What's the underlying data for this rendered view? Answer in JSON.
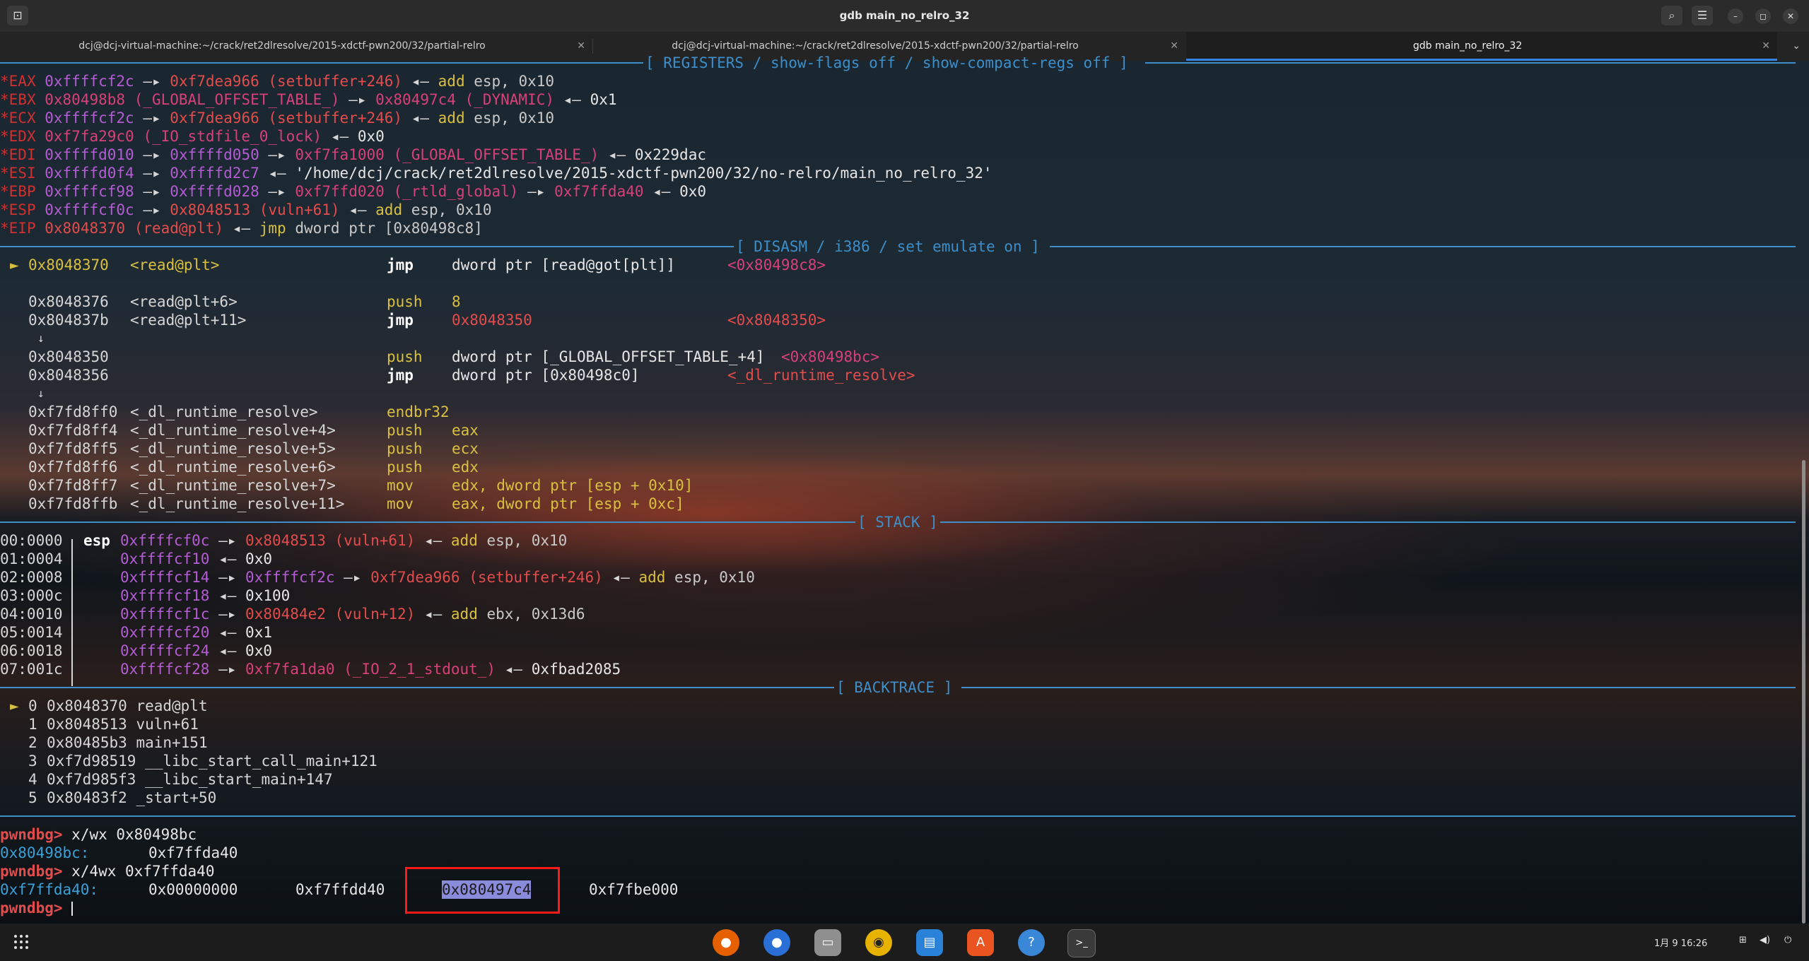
{
  "window": {
    "title": "gdb main_no_relro_32",
    "buttons": {
      "search": "⌕",
      "menu": "☰",
      "minimize": "–",
      "maximize": "◻",
      "close": "✕"
    }
  },
  "tabs": [
    {
      "label": "dcj@dcj-virtual-machine:~/crack/ret2dlresolve/2015-xdctf-pwn200/32/partial-relro",
      "active": false
    },
    {
      "label": "dcj@dcj-virtual-machine:~/crack/ret2dlresolve/2015-xdctf-pwn200/32/partial-relro",
      "active": false
    },
    {
      "label": "gdb main_no_relro_32",
      "active": true
    }
  ],
  "headers": {
    "registers": "[ REGISTERS / show-flags off / show-compact-regs off ]",
    "disasm": "[ DISASM / i386 / set emulate on ]",
    "stack": "[ STACK ]",
    "backtrace": "[ BACKTRACE ]"
  },
  "registers": [
    {
      "star": "*",
      "name": "EAX",
      "v1": "0xffffcf2c",
      "a1": "—▸",
      "v2": "0xf7dea966",
      "sym": "(setbuffer+246)",
      "a2": "◂—",
      "ins": "add",
      "opr": "esp, 0x10"
    },
    {
      "star": "*",
      "name": "EBX",
      "v1": "0x80498b8",
      "sym1": "(_GLOBAL_OFFSET_TABLE_)",
      "a1": "—▸",
      "v2": "0x80497c4",
      "sym": "(_DYNAMIC)",
      "a2": "◂—",
      "tail": "0x1"
    },
    {
      "star": "*",
      "name": "ECX",
      "v1": "0xffffcf2c",
      "a1": "—▸",
      "v2": "0xf7dea966",
      "sym": "(setbuffer+246)",
      "a2": "◂—",
      "ins": "add",
      "opr": "esp, 0x10"
    },
    {
      "star": "*",
      "name": "EDX",
      "v1": "0xf7fa29c0",
      "sym1": "(_IO_stdfile_0_lock)",
      "a2": "◂—",
      "tail": "0x0"
    },
    {
      "star": "*",
      "name": "EDI",
      "v1": "0xffffd010",
      "a1": "—▸",
      "v2": "0xffffd050",
      "a3": "—▸",
      "v3": "0xf7fa1000",
      "sym": "(_GLOBAL_OFFSET_TABLE_)",
      "a2": "◂—",
      "tail": "0x229dac"
    },
    {
      "star": "*",
      "name": "ESI",
      "v1": "0xffffd0f4",
      "a1": "—▸",
      "v2": "0xffffd2c7",
      "a2": "◂—",
      "str": "'/home/dcj/crack/ret2dlresolve/2015-xdctf-pwn200/32/no-relro/main_no_relro_32'"
    },
    {
      "star": "*",
      "name": "EBP",
      "v1": "0xffffcf98",
      "a1": "—▸",
      "v2": "0xffffd028",
      "a3": "—▸",
      "v3": "0xf7ffd020",
      "sym": "(_rtld_global)",
      "a4": "—▸",
      "v4": "0xf7ffda40",
      "a2": "◂—",
      "tail": "0x0"
    },
    {
      "star": "*",
      "name": "ESP",
      "v1": "0xffffcf0c",
      "a1": "—▸",
      "v2": "0x8048513",
      "sym": "(vuln+61)",
      "a2": "◂—",
      "ins": "add",
      "opr": "esp, 0x10"
    },
    {
      "star": "*",
      "name": "EIP",
      "v1": "0x8048370",
      "sym": "(read@plt)",
      "a2": "◂—",
      "ins": "jmp",
      "opr": "dword ptr [0x80498c8]"
    }
  ],
  "disasm": [
    {
      "marker": "►",
      "addr": "0x8048370",
      "sym": "<read@plt>",
      "mnem": "jmp",
      "ops": "dword ptr [read@got[plt]]",
      "cmt": "<0x80498c8>",
      "current": true
    },
    {
      "marker": "",
      "addr": "",
      "sym": "",
      "mnem": "",
      "ops": "",
      "cmt": ""
    },
    {
      "marker": "",
      "addr": "0x8048376",
      "sym": "<read@plt+6>",
      "mnem": "push",
      "ops": "8",
      "cmt": ""
    },
    {
      "marker": "",
      "addr": "0x804837b",
      "sym": "<read@plt+11>",
      "mnem": "jmp",
      "ops": "0x8048350",
      "cmt": "<0x8048350>"
    },
    {
      "marker": "↓",
      "addr": "",
      "sym": "",
      "mnem": "",
      "ops": "",
      "cmt": ""
    },
    {
      "marker": "",
      "addr": "0x8048350",
      "sym": "",
      "mnem": "push",
      "ops": "dword ptr [_GLOBAL_OFFSET_TABLE_+4]",
      "cmt": "<0x80498bc>"
    },
    {
      "marker": "",
      "addr": "0x8048356",
      "sym": "",
      "mnem": "jmp",
      "ops": "dword ptr [0x80498c0]",
      "cmt": "<_dl_runtime_resolve>"
    },
    {
      "marker": "↓",
      "addr": "",
      "sym": "",
      "mnem": "",
      "ops": "",
      "cmt": ""
    },
    {
      "marker": "",
      "addr": "0xf7fd8ff0",
      "sym": "<_dl_runtime_resolve>",
      "mnem": "endbr32",
      "ops": "",
      "cmt": ""
    },
    {
      "marker": "",
      "addr": "0xf7fd8ff4",
      "sym": "<_dl_runtime_resolve+4>",
      "mnem": "push",
      "ops": "eax",
      "cmt": ""
    },
    {
      "marker": "",
      "addr": "0xf7fd8ff5",
      "sym": "<_dl_runtime_resolve+5>",
      "mnem": "push",
      "ops": "ecx",
      "cmt": ""
    },
    {
      "marker": "",
      "addr": "0xf7fd8ff6",
      "sym": "<_dl_runtime_resolve+6>",
      "mnem": "push",
      "ops": "edx",
      "cmt": ""
    },
    {
      "marker": "",
      "addr": "0xf7fd8ff7",
      "sym": "<_dl_runtime_resolve+7>",
      "mnem": "mov",
      "ops": "edx, dword ptr [esp + 0x10]",
      "cmt": ""
    },
    {
      "marker": "",
      "addr": "0xf7fd8ffb",
      "sym": "<_dl_runtime_resolve+11>",
      "mnem": "mov",
      "ops": "eax, dword ptr [esp + 0xc]",
      "cmt": ""
    }
  ],
  "stack": [
    {
      "idx": "00:0000",
      "reg": "esp",
      "addr": "0xffffcf0c",
      "a1": "—▸",
      "v1": "0x8048513",
      "sym": "(vuln+61)",
      "a2": "◂—",
      "ins": "add",
      "opr": "esp, 0x10"
    },
    {
      "idx": "01:0004",
      "reg": "",
      "addr": "0xffffcf10",
      "a2": "◂—",
      "tail": "0x0"
    },
    {
      "idx": "02:0008",
      "reg": "",
      "addr": "0xffffcf14",
      "a1": "—▸",
      "v1": "0xffffcf2c",
      "a3": "—▸",
      "v2": "0xf7dea966",
      "sym": "(setbuffer+246)",
      "a2": "◂—",
      "ins": "add",
      "opr": "esp, 0x10"
    },
    {
      "idx": "03:000c",
      "reg": "",
      "addr": "0xffffcf18",
      "a2": "◂—",
      "tail": "0x100"
    },
    {
      "idx": "04:0010",
      "reg": "",
      "addr": "0xffffcf1c",
      "a1": "—▸",
      "v1": "0x80484e2",
      "sym": "(vuln+12)",
      "a2": "◂—",
      "ins": "add",
      "opr": "ebx, 0x13d6"
    },
    {
      "idx": "05:0014",
      "reg": "",
      "addr": "0xffffcf20",
      "a2": "◂—",
      "tail": "0x1"
    },
    {
      "idx": "06:0018",
      "reg": "",
      "addr": "0xffffcf24",
      "a2": "◂—",
      "tail": "0x0"
    },
    {
      "idx": "07:001c",
      "reg": "",
      "addr": "0xffffcf28",
      "a1": "—▸",
      "v1": "0xf7fa1da0",
      "sym": "(_IO_2_1_stdout_)",
      "a2": "◂—",
      "tail": "0xfbad2085"
    }
  ],
  "backtrace": [
    {
      "marker": "►",
      "num": "0",
      "addr": "0x8048370",
      "func": "read@plt"
    },
    {
      "marker": "",
      "num": "1",
      "addr": "0x8048513",
      "func": "vuln+61"
    },
    {
      "marker": "",
      "num": "2",
      "addr": "0x80485b3",
      "func": "main+151"
    },
    {
      "marker": "",
      "num": "3",
      "addr": "0xf7d98519",
      "func": "__libc_start_call_main+121"
    },
    {
      "marker": "",
      "num": "4",
      "addr": "0xf7d985f3",
      "func": "__libc_start_main+147"
    },
    {
      "marker": "",
      "num": "5",
      "addr": "0x80483f2",
      "func": "_start+50"
    }
  ],
  "console": {
    "prompt": "pwndbg>",
    "cmd1": "x/wx 0x80498bc",
    "out1_addr": "0x80498bc:",
    "out1_val": "0xf7ffda40",
    "cmd2": "x/4wx 0xf7ffda40",
    "out2_addr": "0xf7ffda40:",
    "out2_v1": "0x00000000",
    "out2_v2": "0xf7ffdd40",
    "out2_v3": "0x080497c4",
    "out2_v4": "0xf7fbe000"
  },
  "taskbar": {
    "apps_icon": "⋮⋮⋮",
    "dock": [
      {
        "name": "firefox-icon",
        "glyph": "●",
        "color": "#e66000"
      },
      {
        "name": "thunderbird-icon",
        "glyph": "●",
        "color": "#2a6fd6"
      },
      {
        "name": "files-icon",
        "glyph": "▭",
        "color": "#9a9a9a"
      },
      {
        "name": "rhythmbox-icon",
        "glyph": "◉",
        "color": "#e8b300"
      },
      {
        "name": "writer-icon",
        "glyph": "▤",
        "color": "#2a82d8"
      },
      {
        "name": "appcenter-icon",
        "glyph": "A",
        "color": "#e95420"
      },
      {
        "name": "help-icon",
        "glyph": "?",
        "color": "#3a87d8"
      },
      {
        "name": "terminal-icon",
        "glyph": ">_",
        "color": "#3a3a3a"
      }
    ],
    "clock": "1月 9  16:26",
    "tray": {
      "network": "⊞",
      "volume": "◀)",
      "power": "⏻"
    }
  }
}
